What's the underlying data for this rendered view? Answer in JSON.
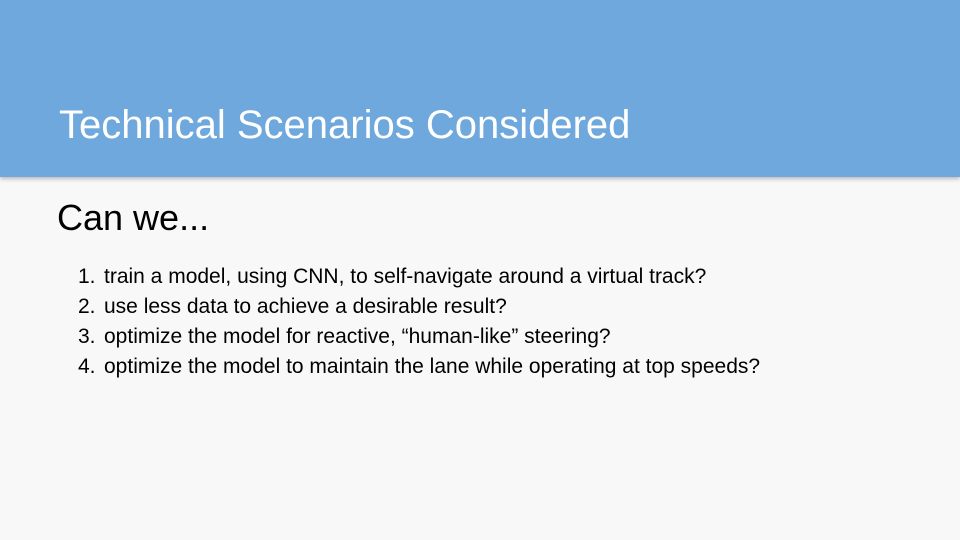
{
  "slide": {
    "title": "Technical Scenarios Considered",
    "subheading": "Can we...",
    "items": [
      {
        "number": "1.",
        "text": "train a model, using CNN, to self-navigate around a virtual track?"
      },
      {
        "number": "2.",
        "text": "use less data to achieve a desirable result?"
      },
      {
        "number": "3.",
        "text": "optimize the model for reactive, “human-like” steering?"
      },
      {
        "number": "4.",
        "text": "optimize the model to maintain the lane while operating at top speeds?"
      }
    ]
  },
  "colors": {
    "header_band": "#6fa8dc",
    "background": "#f8f8f8",
    "title_text": "#ffffff",
    "body_text": "#000000"
  }
}
